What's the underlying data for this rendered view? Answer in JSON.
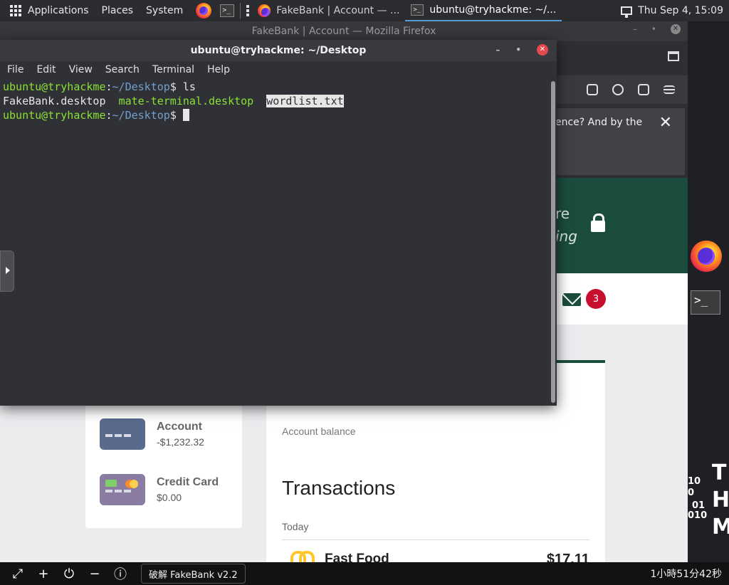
{
  "top_panel": {
    "menus": [
      "Applications",
      "Places",
      "System"
    ],
    "tasks": [
      {
        "label": "FakeBank | Account — ...",
        "icon": "firefox-icon",
        "active": false
      },
      {
        "label": "ubuntu@tryhackme: ~/...",
        "icon": "terminal-icon",
        "active": true
      }
    ],
    "clock": "Thu Sep  4, 15:09"
  },
  "firefox": {
    "title": "FakeBank | Account — Mozilla Firefox",
    "notification_text": "ence? And by the",
    "hero_line1": "re",
    "hero_line2": "ing",
    "message_count": "3",
    "balance_label": "Account balance",
    "transactions_title": "Transactions",
    "tx_group": "Today",
    "transactions": [
      {
        "name": "Fast Food",
        "amount": "$17.11",
        "icon": "mcdonalds-icon"
      }
    ],
    "accounts": [
      {
        "name": "Account",
        "value": "-$1,232.32"
      },
      {
        "name": "Credit Card",
        "value": "$0.00"
      }
    ]
  },
  "terminal": {
    "title": "ubuntu@tryhackme: ~/Desktop",
    "menu": [
      "File",
      "Edit",
      "View",
      "Search",
      "Terminal",
      "Help"
    ],
    "prompt_user": "ubuntu@tryhackme",
    "prompt_sep": ":",
    "prompt_path": "~/Desktop",
    "prompt_end": "$ ",
    "command": "ls",
    "files": [
      "FakeBank.desktop",
      "mate-terminal.desktop",
      "wordlist.txt"
    ]
  },
  "desktop_logo": {
    "letters": [
      "T",
      "H",
      "M"
    ],
    "binary": [
      "10",
      "0",
      "01",
      "010"
    ]
  },
  "bottom_bar": {
    "chip_label": "破解 FakeBank v2.2",
    "timer": "1小時51分42秒"
  },
  "colors": {
    "bank_green": "#1b4d3e",
    "badge_red": "#c8102e",
    "prompt_green": "#8ae234",
    "prompt_blue": "#729fcf"
  }
}
